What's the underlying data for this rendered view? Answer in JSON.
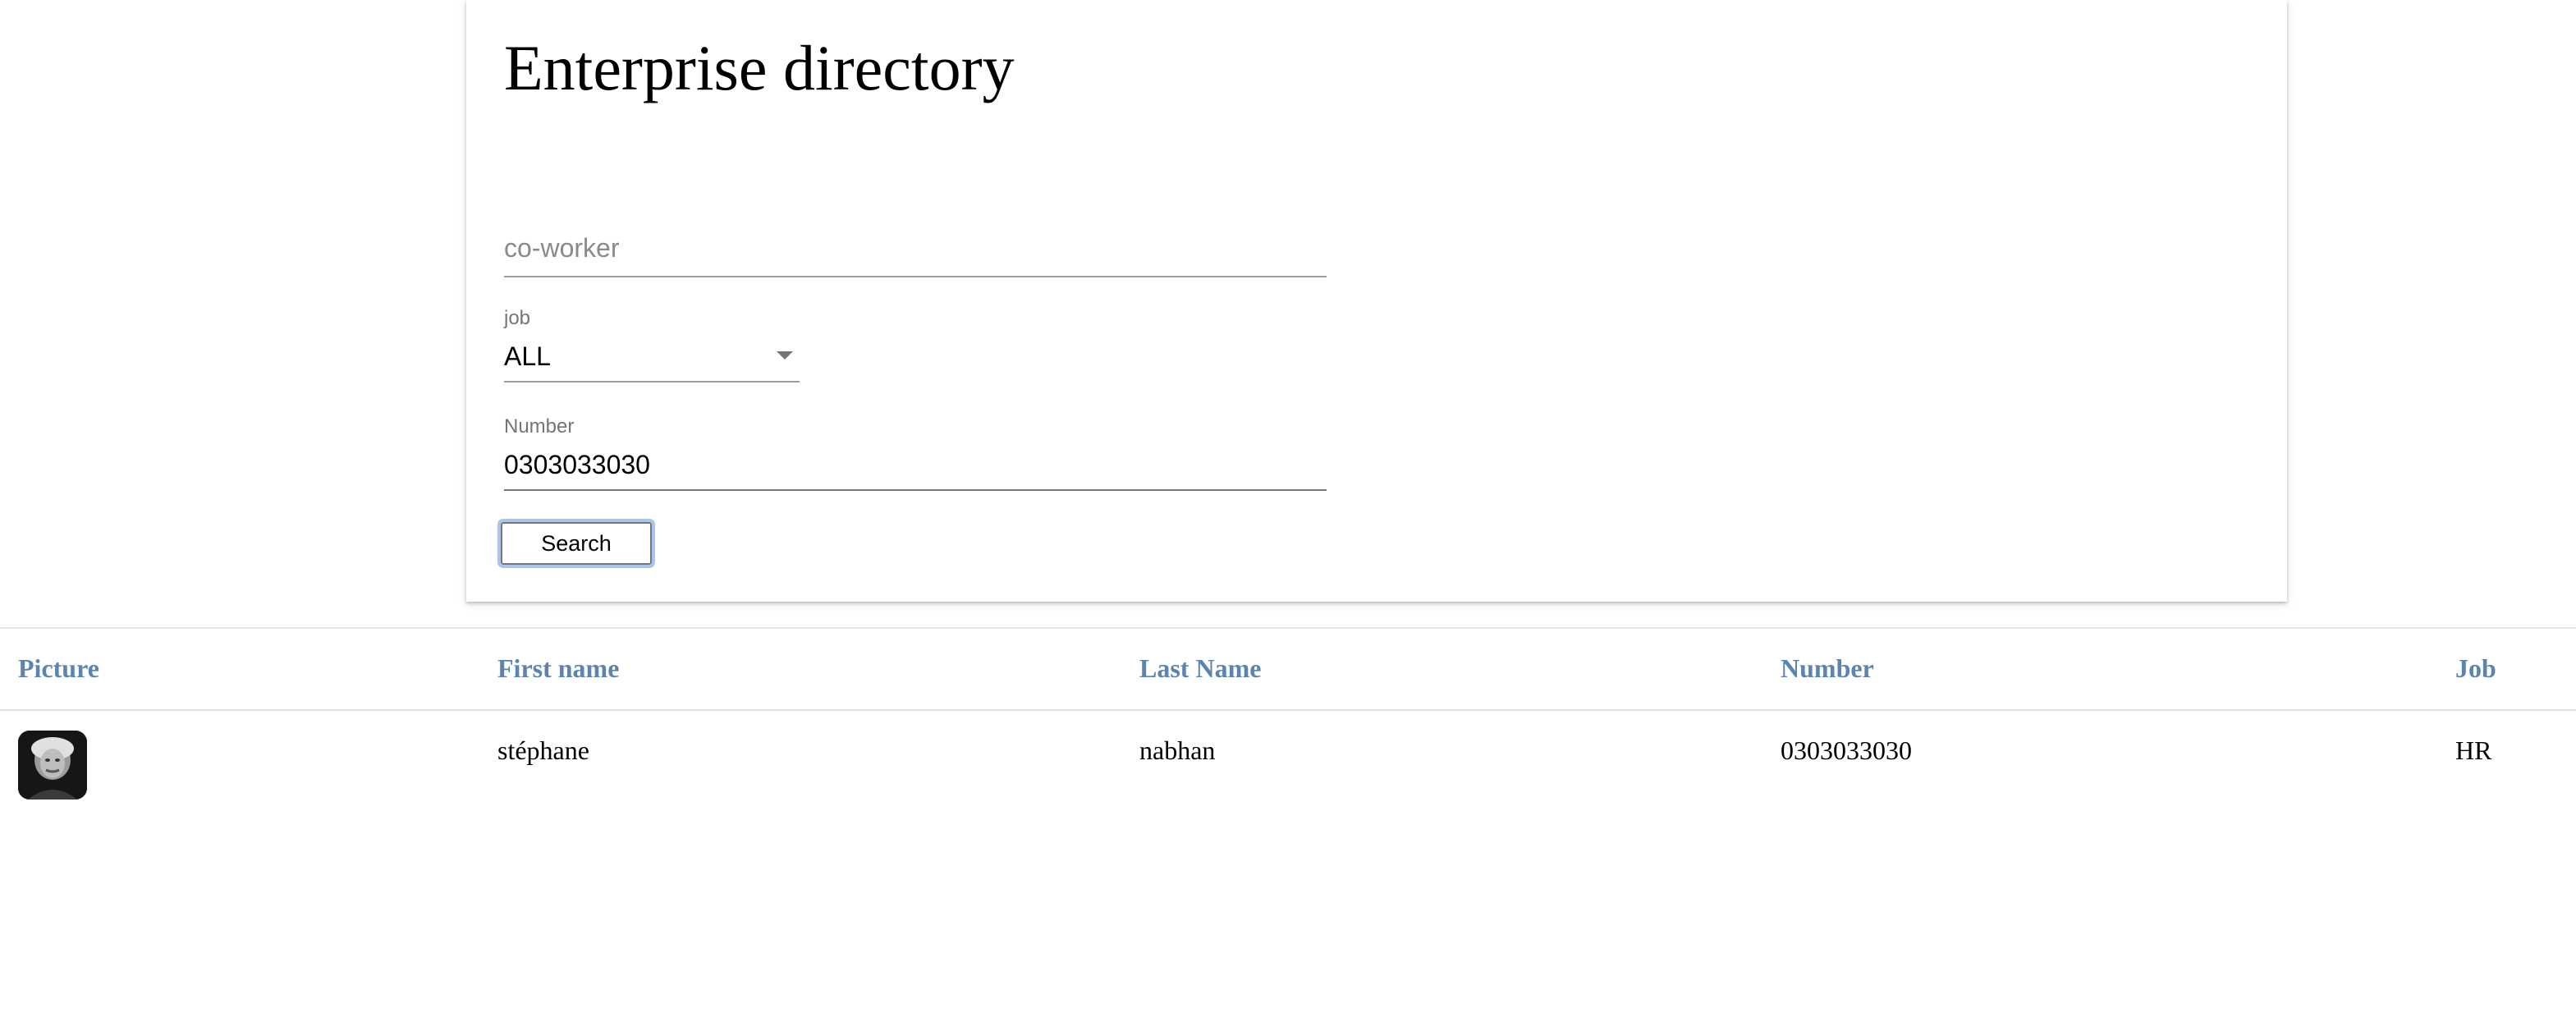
{
  "page": {
    "title": "Enterprise directory"
  },
  "form": {
    "coworker": {
      "placeholder": "co-worker",
      "value": ""
    },
    "job": {
      "label": "job",
      "value": "ALL"
    },
    "number": {
      "label": "Number",
      "value": "0303033030"
    },
    "search_label": "Search"
  },
  "table": {
    "headers": [
      "Picture",
      "First name",
      "Last Name",
      "Number",
      "Job"
    ],
    "rows": [
      {
        "picture": "avatar-photo",
        "first_name": "stéphane",
        "last_name": "nabhan",
        "number": "0303033030",
        "job": "HR"
      }
    ]
  },
  "colors": {
    "header_text": "#5b84b1",
    "focus_ring": "#a7c5ee"
  }
}
